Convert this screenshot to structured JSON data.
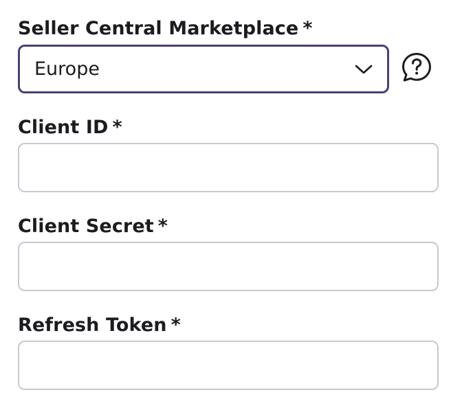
{
  "form": {
    "marketplace": {
      "label": "Seller Central Marketplace",
      "required_marker": "*",
      "selected_value": "Europe",
      "help_icon": "help-chat-question-icon",
      "chevron_icon": "chevron-down-icon"
    },
    "client_id": {
      "label": "Client ID",
      "required_marker": "*",
      "value": "",
      "placeholder": ""
    },
    "client_secret": {
      "label": "Client Secret",
      "required_marker": "*",
      "value": "",
      "placeholder": ""
    },
    "refresh_token": {
      "label": "Refresh Token",
      "required_marker": "*",
      "value": "",
      "placeholder": ""
    }
  },
  "colors": {
    "focus_border": "#4b3f72",
    "input_border": "#c9c7d1",
    "text": "#1c1b1f"
  }
}
